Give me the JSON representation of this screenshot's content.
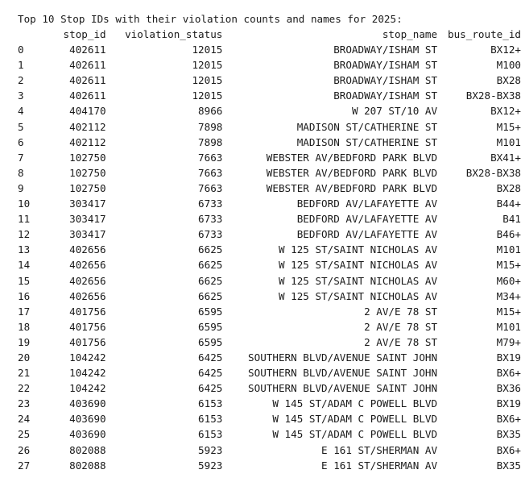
{
  "output": {
    "title": "Top 10 Stop IDs with their violation counts and names for 2025:",
    "columns": {
      "index": "",
      "stop_id": "stop_id",
      "violation_status": "violation_status",
      "stop_name": "stop_name",
      "bus_route_id": "bus_route_id"
    },
    "rows": [
      {
        "idx": "0",
        "stop_id": "402611",
        "violation_status": "12015",
        "stop_name": "BROADWAY/ISHAM ST",
        "bus_route_id": "BX12+"
      },
      {
        "idx": "1",
        "stop_id": "402611",
        "violation_status": "12015",
        "stop_name": "BROADWAY/ISHAM ST",
        "bus_route_id": "M100"
      },
      {
        "idx": "2",
        "stop_id": "402611",
        "violation_status": "12015",
        "stop_name": "BROADWAY/ISHAM ST",
        "bus_route_id": "BX28"
      },
      {
        "idx": "3",
        "stop_id": "402611",
        "violation_status": "12015",
        "stop_name": "BROADWAY/ISHAM ST",
        "bus_route_id": "BX28-BX38"
      },
      {
        "idx": "4",
        "stop_id": "404170",
        "violation_status": "8966",
        "stop_name": "W 207 ST/10 AV",
        "bus_route_id": "BX12+"
      },
      {
        "idx": "5",
        "stop_id": "402112",
        "violation_status": "7898",
        "stop_name": "MADISON ST/CATHERINE ST",
        "bus_route_id": "M15+"
      },
      {
        "idx": "6",
        "stop_id": "402112",
        "violation_status": "7898",
        "stop_name": "MADISON ST/CATHERINE ST",
        "bus_route_id": "M101"
      },
      {
        "idx": "7",
        "stop_id": "102750",
        "violation_status": "7663",
        "stop_name": "WEBSTER AV/BEDFORD PARK BLVD",
        "bus_route_id": "BX41+"
      },
      {
        "idx": "8",
        "stop_id": "102750",
        "violation_status": "7663",
        "stop_name": "WEBSTER AV/BEDFORD PARK BLVD",
        "bus_route_id": "BX28-BX38"
      },
      {
        "idx": "9",
        "stop_id": "102750",
        "violation_status": "7663",
        "stop_name": "WEBSTER AV/BEDFORD PARK BLVD",
        "bus_route_id": "BX28"
      },
      {
        "idx": "10",
        "stop_id": "303417",
        "violation_status": "6733",
        "stop_name": "BEDFORD AV/LAFAYETTE AV",
        "bus_route_id": "B44+"
      },
      {
        "idx": "11",
        "stop_id": "303417",
        "violation_status": "6733",
        "stop_name": "BEDFORD AV/LAFAYETTE AV",
        "bus_route_id": "B41"
      },
      {
        "idx": "12",
        "stop_id": "303417",
        "violation_status": "6733",
        "stop_name": "BEDFORD AV/LAFAYETTE AV",
        "bus_route_id": "B46+"
      },
      {
        "idx": "13",
        "stop_id": "402656",
        "violation_status": "6625",
        "stop_name": "W 125 ST/SAINT NICHOLAS AV",
        "bus_route_id": "M101"
      },
      {
        "idx": "14",
        "stop_id": "402656",
        "violation_status": "6625",
        "stop_name": "W 125 ST/SAINT NICHOLAS AV",
        "bus_route_id": "M15+"
      },
      {
        "idx": "15",
        "stop_id": "402656",
        "violation_status": "6625",
        "stop_name": "W 125 ST/SAINT NICHOLAS AV",
        "bus_route_id": "M60+"
      },
      {
        "idx": "16",
        "stop_id": "402656",
        "violation_status": "6625",
        "stop_name": "W 125 ST/SAINT NICHOLAS AV",
        "bus_route_id": "M34+"
      },
      {
        "idx": "17",
        "stop_id": "401756",
        "violation_status": "6595",
        "stop_name": "2 AV/E 78 ST",
        "bus_route_id": "M15+"
      },
      {
        "idx": "18",
        "stop_id": "401756",
        "violation_status": "6595",
        "stop_name": "2 AV/E 78 ST",
        "bus_route_id": "M101"
      },
      {
        "idx": "19",
        "stop_id": "401756",
        "violation_status": "6595",
        "stop_name": "2 AV/E 78 ST",
        "bus_route_id": "M79+"
      },
      {
        "idx": "20",
        "stop_id": "104242",
        "violation_status": "6425",
        "stop_name": "SOUTHERN BLVD/AVENUE SAINT JOHN",
        "bus_route_id": "BX19"
      },
      {
        "idx": "21",
        "stop_id": "104242",
        "violation_status": "6425",
        "stop_name": "SOUTHERN BLVD/AVENUE SAINT JOHN",
        "bus_route_id": "BX6+"
      },
      {
        "idx": "22",
        "stop_id": "104242",
        "violation_status": "6425",
        "stop_name": "SOUTHERN BLVD/AVENUE SAINT JOHN",
        "bus_route_id": "BX36"
      },
      {
        "idx": "23",
        "stop_id": "403690",
        "violation_status": "6153",
        "stop_name": "W 145 ST/ADAM C POWELL BLVD",
        "bus_route_id": "BX19"
      },
      {
        "idx": "24",
        "stop_id": "403690",
        "violation_status": "6153",
        "stop_name": "W 145 ST/ADAM C POWELL BLVD",
        "bus_route_id": "BX6+"
      },
      {
        "idx": "25",
        "stop_id": "403690",
        "violation_status": "6153",
        "stop_name": "W 145 ST/ADAM C POWELL BLVD",
        "bus_route_id": "BX35"
      },
      {
        "idx": "26",
        "stop_id": "802088",
        "violation_status": "5923",
        "stop_name": "E 161 ST/SHERMAN AV",
        "bus_route_id": "BX6+"
      },
      {
        "idx": "27",
        "stop_id": "802088",
        "violation_status": "5923",
        "stop_name": "E 161 ST/SHERMAN AV",
        "bus_route_id": "BX35"
      }
    ]
  }
}
